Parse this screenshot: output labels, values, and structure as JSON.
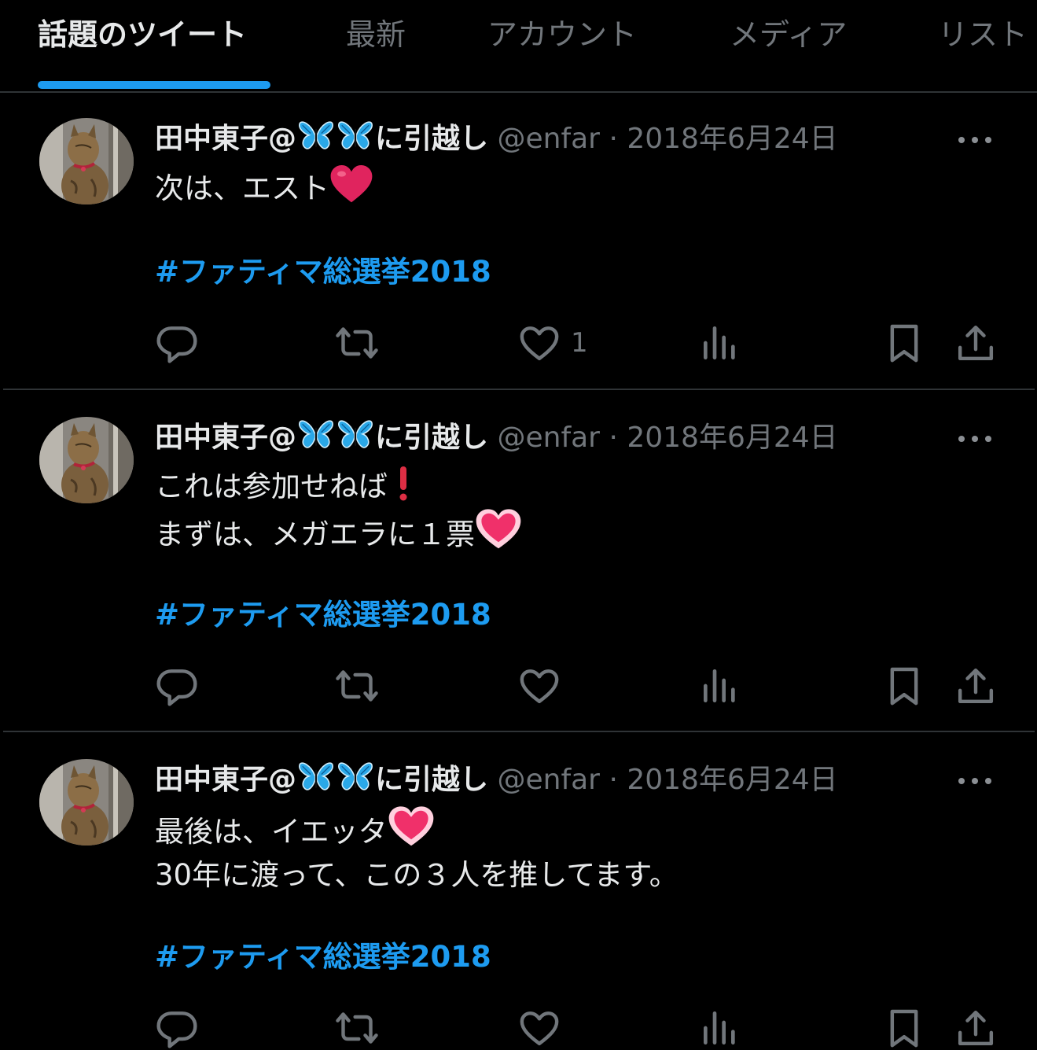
{
  "tabs": [
    {
      "label": "話題のツイート"
    },
    {
      "label": "最新"
    },
    {
      "label": "アカウント"
    },
    {
      "label": "メディア"
    },
    {
      "label": "リスト"
    }
  ],
  "colors": {
    "accent": "#1d9bf0",
    "background": "#000000",
    "muted": "#71767b",
    "text": "#e7e9ea"
  },
  "tweets": [
    {
      "name_prefix": "田中東子@",
      "name_suffix": "に引越し",
      "handle": "@enfar",
      "separator": "·",
      "date": "2018年6月24日",
      "lines": [
        "次は、エスト"
      ],
      "hashtag": "#ファティマ総選挙2018",
      "like_count": "1"
    },
    {
      "name_prefix": "田中東子@",
      "name_suffix": "に引越し",
      "handle": "@enfar",
      "separator": "·",
      "date": "2018年6月24日",
      "lines": [
        "これは参加せねば",
        "まずは、メガエラに１票"
      ],
      "hashtag": "#ファティマ総選挙2018",
      "like_count": ""
    },
    {
      "name_prefix": "田中東子@",
      "name_suffix": "に引越し",
      "handle": "@enfar",
      "separator": "·",
      "date": "2018年6月24日",
      "lines": [
        "最後は、イエッタ",
        "30年に渡って、この３人を推してます。"
      ],
      "hashtag": "#ファティマ総選挙2018",
      "like_count": ""
    }
  ],
  "icons": [
    "reply-icon",
    "retweet-icon",
    "like-icon",
    "views-icon",
    "bookmark-icon",
    "share-icon",
    "more-icon",
    "butterfly-icon",
    "heart-emoji",
    "exclamation-emoji"
  ]
}
